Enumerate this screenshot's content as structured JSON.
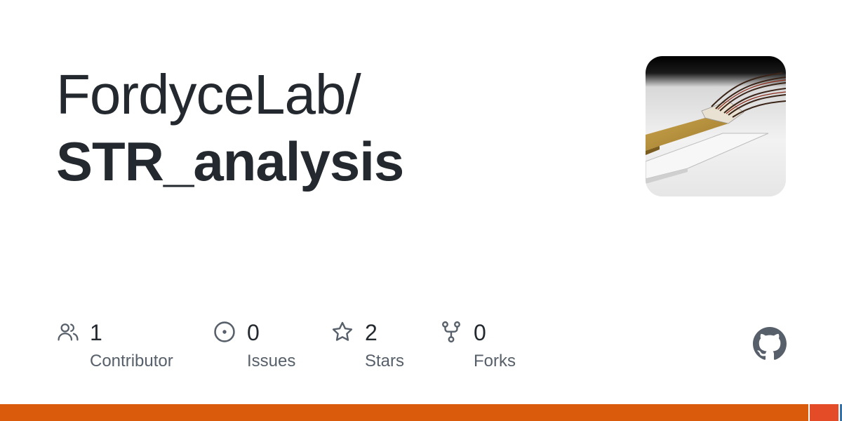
{
  "repo": {
    "owner": "FordyceLab/",
    "name": "STR_analysis"
  },
  "stats": [
    {
      "icon": "contributors-icon",
      "value": "1",
      "label": "Contributor"
    },
    {
      "icon": "issue-icon",
      "value": "0",
      "label": "Issues"
    },
    {
      "icon": "star-icon",
      "value": "2",
      "label": "Stars"
    },
    {
      "icon": "fork-icon",
      "value": "0",
      "label": "Forks"
    }
  ],
  "language_bar": [
    {
      "color": "#DA5B0B",
      "share": 0.96
    },
    {
      "color": "#e34c26",
      "share": 0.036
    },
    {
      "color": "#3572A5",
      "share": 0.004
    }
  ],
  "colors": {
    "text": "#24292f",
    "muted": "#57606a",
    "icon": "#57606a"
  }
}
